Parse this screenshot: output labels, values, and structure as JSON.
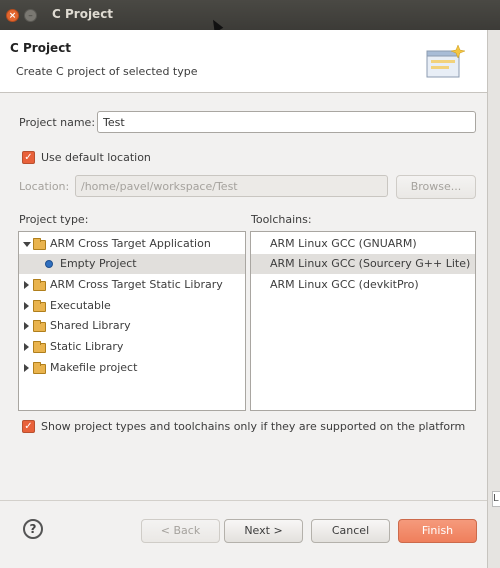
{
  "window": {
    "title": "C Project"
  },
  "header": {
    "title": "C Project",
    "description": "Create C project of selected type",
    "icon": "wizard-banner-icon"
  },
  "form": {
    "project_name_label": "Project name:",
    "project_name_value": "Test",
    "use_default_location_label": "Use default location",
    "use_default_location_checked": true,
    "location_label": "Location:",
    "location_value": "/home/pavel/workspace/Test",
    "browse_label": "Browse..."
  },
  "project_types": {
    "label": "Project type:",
    "items": [
      {
        "label": "ARM Cross Target Application",
        "expanded": true,
        "icon": "folder-icon"
      },
      {
        "label": "Empty Project",
        "selected": true,
        "icon": "bullet-icon"
      },
      {
        "label": "ARM Cross Target Static Library",
        "expanded": false,
        "icon": "folder-icon"
      },
      {
        "label": "Executable",
        "expanded": false,
        "icon": "folder-icon"
      },
      {
        "label": "Shared Library",
        "expanded": false,
        "icon": "folder-icon"
      },
      {
        "label": "Static Library",
        "expanded": false,
        "icon": "folder-icon"
      },
      {
        "label": "Makefile project",
        "expanded": false,
        "icon": "folder-icon"
      }
    ]
  },
  "toolchains": {
    "label": "Toolchains:",
    "items": [
      {
        "label": "ARM Linux GCC (GNUARM)",
        "selected": false
      },
      {
        "label": "ARM Linux GCC (Sourcery G++ Lite)",
        "selected": true
      },
      {
        "label": "ARM Linux GCC (devkitPro)",
        "selected": false
      }
    ]
  },
  "filter": {
    "label": "Show project types and toolchains only if they are supported on the platform",
    "checked": true
  },
  "buttons": {
    "back": "< Back",
    "next": "Next >",
    "cancel": "Cancel",
    "finish": "Finish"
  },
  "side_strip": {
    "text": "L"
  },
  "colors": {
    "accent": "#ef7f5c",
    "selection": "#e1dfdc",
    "titlebar": "#3c3b37"
  }
}
